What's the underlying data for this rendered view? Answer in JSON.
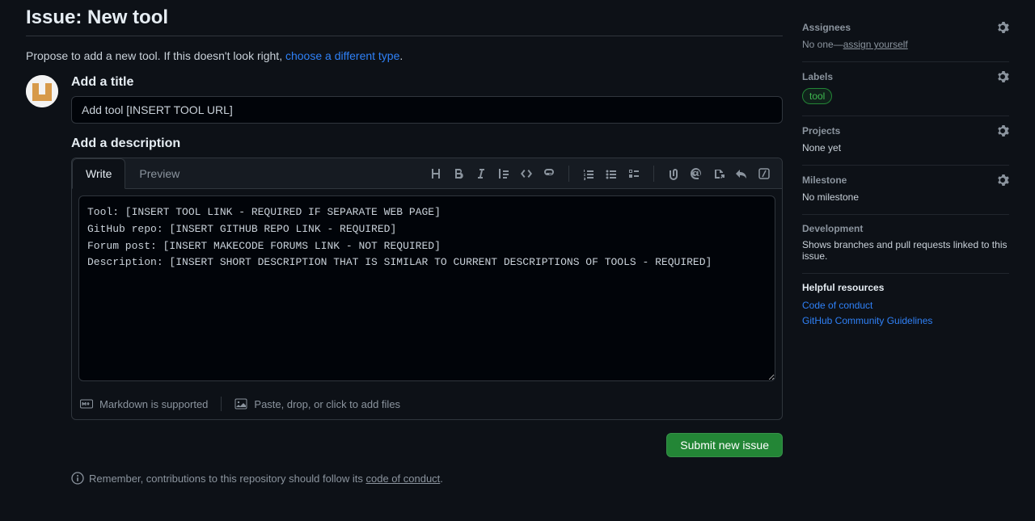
{
  "page": {
    "title": "Issue: New tool",
    "subtitle_prefix": "Propose to add a new tool. If this doesn't look right, ",
    "subtitle_link": "choose a different type",
    "subtitle_suffix": "."
  },
  "form": {
    "title_label": "Add a title",
    "title_value": "Add tool [INSERT TOOL URL]",
    "description_label": "Add a description",
    "tabs": {
      "write": "Write",
      "preview": "Preview"
    },
    "description_value": "Tool: [INSERT TOOL LINK - REQUIRED IF SEPARATE WEB PAGE]\nGitHub repo: [INSERT GITHUB REPO LINK - REQUIRED]\nForum post: [INSERT MAKECODE FORUMS LINK - NOT REQUIRED]\nDescription: [INSERT SHORT DESCRIPTION THAT IS SIMILAR TO CURRENT DESCRIPTIONS OF TOOLS - REQUIRED]",
    "markdown_hint": "Markdown is supported",
    "attach_hint": "Paste, drop, or click to add files",
    "submit_label": "Submit new issue"
  },
  "note": {
    "prefix": "Remember, contributions to this repository should follow its ",
    "link": "code of conduct",
    "suffix": "."
  },
  "sidebar": {
    "assignees": {
      "title": "Assignees",
      "none_prefix": "No one—",
      "assign_self": "assign yourself"
    },
    "labels": {
      "title": "Labels",
      "items": [
        "tool"
      ]
    },
    "projects": {
      "title": "Projects",
      "value": "None yet"
    },
    "milestone": {
      "title": "Milestone",
      "value": "No milestone"
    },
    "development": {
      "title": "Development",
      "text": "Shows branches and pull requests linked to this issue."
    },
    "resources": {
      "title": "Helpful resources",
      "links": [
        "Code of conduct",
        "GitHub Community Guidelines"
      ]
    }
  }
}
